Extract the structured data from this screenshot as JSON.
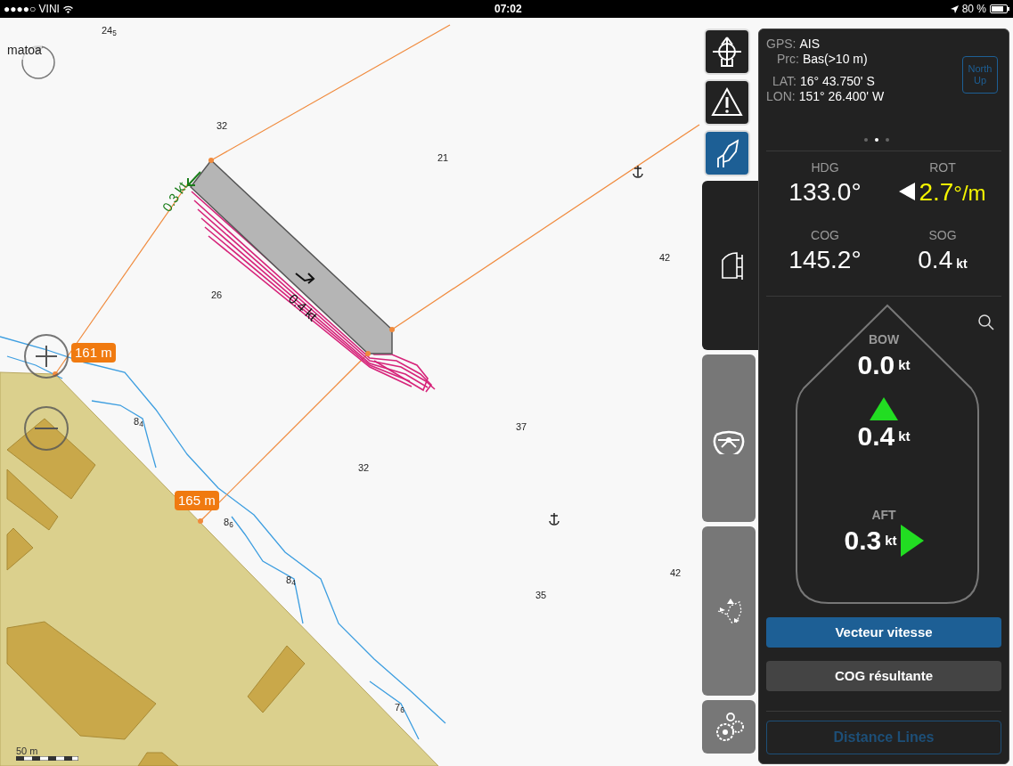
{
  "status_bar": {
    "carrier": "●●●●○ VINI",
    "time": "07:02",
    "battery": "80 %"
  },
  "map": {
    "place_label": "matoa",
    "soundings": [
      "24$_{5}$",
      "32",
      "21",
      "42",
      "26",
      "8$_{4}$",
      "37",
      "32",
      "8$_{6}$",
      "8$_{4}$",
      "42",
      "35",
      "7$_{6}$"
    ],
    "distance_labels": [
      "161 m",
      "165 m"
    ],
    "vectors": [
      {
        "kind": "aft",
        "label": "0.3 kt"
      },
      {
        "kind": "sog",
        "label": "0.4 kt"
      }
    ],
    "scale": "50 m"
  },
  "tools": [
    {
      "kind": "target",
      "selected": false
    },
    {
      "kind": "warning",
      "selected": false
    },
    {
      "kind": "boat",
      "selected": true
    }
  ],
  "tabs": [
    {
      "kind": "ship",
      "selected": true
    },
    {
      "kind": "wheel",
      "selected": false
    },
    {
      "kind": "route",
      "selected": false
    },
    {
      "kind": "gears",
      "selected": false
    }
  ],
  "panel": {
    "gps": [
      {
        "label": "GPS:",
        "value": "AIS"
      },
      {
        "label": "Prc:",
        "value": "Bas(>10 m)"
      },
      {
        "label": "LAT:",
        "value": "16° 43.750' S"
      },
      {
        "label": "LON:",
        "value": "151° 26.400' W"
      }
    ],
    "north_up": {
      "label": "North Up",
      "disabled": true
    },
    "page_dots": [
      {
        "selected": false
      },
      {
        "selected": true
      },
      {
        "selected": false
      }
    ],
    "readouts": [
      {
        "kind": "plain",
        "label": "HDG",
        "value": "133.0°"
      },
      {
        "kind": "rot",
        "label": "ROT",
        "value": "2.7",
        "unit": "°/m"
      },
      {
        "kind": "plain",
        "label": "COG",
        "value": "145.2°"
      },
      {
        "kind": "unit",
        "label": "SOG",
        "value": "0.4",
        "unit": "kt"
      }
    ],
    "thruster": {
      "bow": {
        "label": "BOW",
        "value": "0.0",
        "unit": "kt"
      },
      "center": {
        "value": "0.4",
        "unit": "kt"
      },
      "aft": {
        "label": "AFT",
        "value": "0.3",
        "unit": "kt"
      }
    },
    "buttons": [
      {
        "label": "Vecteur vitesse",
        "selected": true
      },
      {
        "label": "COG résultante",
        "selected": false
      }
    ],
    "distance_lines": {
      "label": "Distance Lines",
      "disabled": true
    }
  }
}
